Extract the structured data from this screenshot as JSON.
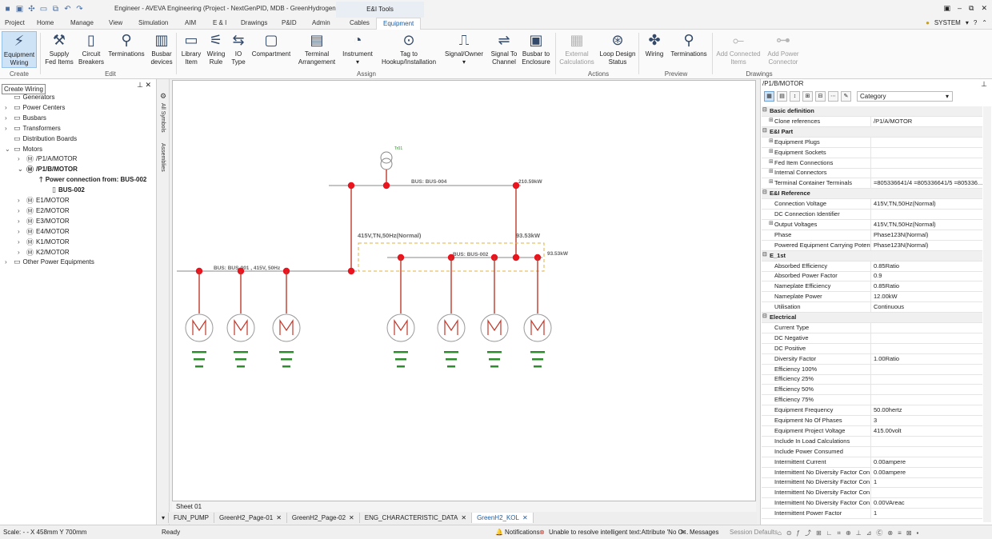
{
  "window": {
    "title": "Engineer - AVEVA Engineering (Project - NextGenPID, MDB - GreenHydrogen)",
    "context_tab": "E&I Tools"
  },
  "menu_tabs": [
    "Project",
    "Home",
    "Manage",
    "View",
    "Simulation",
    "AIM",
    "E & I",
    "Drawings",
    "P&ID",
    "Admin",
    "Cables",
    "Equipment"
  ],
  "active_tab": "Equipment",
  "user": {
    "name": "SYSTEM"
  },
  "ribbon": {
    "buttons": [
      {
        "label": "Equipment\nWiring",
        "icon": "wiring-icon"
      },
      {
        "label": "Supply\nFed Items",
        "icon": "plug-icon"
      },
      {
        "label": "Circuit\nBreakers",
        "icon": "breaker-icon"
      },
      {
        "label": "Terminations",
        "icon": "terminations-icon"
      },
      {
        "label": "Busbar\ndevices",
        "icon": "busbar-icon"
      },
      {
        "label": "Library\nItem",
        "icon": "library-icon"
      },
      {
        "label": "Wiring\nRule",
        "icon": "rule-icon"
      },
      {
        "label": "IO\nType",
        "icon": "io-icon"
      },
      {
        "label": "Compartment",
        "icon": "compartment-icon"
      },
      {
        "label": "Terminal\nArrangement",
        "icon": "terminal-icon"
      },
      {
        "label": "Instrument",
        "icon": "gauge-icon"
      },
      {
        "label": "Tag to\nHookup/Installation",
        "icon": "tag-icon"
      },
      {
        "label": "Signal/Owner",
        "icon": "signal-icon"
      },
      {
        "label": "Signal To\nChannel",
        "icon": "channel-icon"
      },
      {
        "label": "Busbar to\nEnclosure",
        "icon": "enclosure-icon"
      },
      {
        "label": "External\nCalculations",
        "icon": "calc-icon"
      },
      {
        "label": "Loop Design\nStatus",
        "icon": "loop-icon"
      },
      {
        "label": "Wiring",
        "icon": "wiring-preview-icon"
      },
      {
        "label": "Terminations",
        "icon": "terminations-preview-icon"
      },
      {
        "label": "Add Connected\nItems",
        "icon": "add-items-icon"
      },
      {
        "label": "Add Power\nConnector",
        "icon": "add-power-icon"
      }
    ],
    "groups": [
      "Create",
      "Edit",
      "Assign",
      "Actions",
      "Preview",
      "Drawings"
    ]
  },
  "tooltip": "Create Wiring",
  "tree": [
    {
      "label": "Generators",
      "level": 0,
      "exp": "",
      "icon": "folder"
    },
    {
      "label": "Power Centers",
      "level": 0,
      "exp": ">",
      "icon": "folder"
    },
    {
      "label": "Busbars",
      "level": 0,
      "exp": ">",
      "icon": "folder"
    },
    {
      "label": "Transformers",
      "level": 0,
      "exp": ">",
      "icon": "folder"
    },
    {
      "label": "Distribution Boards",
      "level": 0,
      "exp": "",
      "icon": "folder"
    },
    {
      "label": "Motors",
      "level": 0,
      "exp": "v",
      "icon": "folder"
    },
    {
      "label": "/P1/A/MOTOR",
      "level": 1,
      "exp": ">",
      "icon": "motor"
    },
    {
      "label": "/P1/B/MOTOR",
      "level": 1,
      "exp": "v",
      "icon": "motor",
      "bold": true
    },
    {
      "label": "Power connection from: BUS-002",
      "level": 2,
      "exp": "",
      "icon": "arrow",
      "bold": true
    },
    {
      "label": "BUS-002",
      "level": 3,
      "exp": "",
      "icon": "bus",
      "bold": true
    },
    {
      "label": "E1/MOTOR",
      "level": 1,
      "exp": ">",
      "icon": "motor"
    },
    {
      "label": "E2/MOTOR",
      "level": 1,
      "exp": ">",
      "icon": "motor"
    },
    {
      "label": "E3/MOTOR",
      "level": 1,
      "exp": ">",
      "icon": "motor"
    },
    {
      "label": "E4/MOTOR",
      "level": 1,
      "exp": ">",
      "icon": "motor"
    },
    {
      "label": "K1/MOTOR",
      "level": 1,
      "exp": ">",
      "icon": "motor"
    },
    {
      "label": "K2/MOTOR",
      "level": 1,
      "exp": ">",
      "icon": "motor"
    },
    {
      "label": "Other Power Equipments",
      "level": 0,
      "exp": ">",
      "icon": "folder"
    }
  ],
  "side_strip": [
    "All Symbols",
    "Assemblies"
  ],
  "diagram": {
    "bus_labels": [
      "BUS: BUS-004",
      "BUS: BUS-001 , 415V, 50Hz",
      "BUS: BUS-002"
    ],
    "voltage_label": "415V,TN,50Hz(Normal)",
    "power_labels": [
      "210.59kW",
      "93.53kW",
      "93.53kW"
    ],
    "transformer_label": "Tr01"
  },
  "sheet_tab": "Sheet 01",
  "doc_tabs": [
    "FUN_PUMP",
    "GreenH2_Page-01",
    "GreenH2_Page-02",
    "ENG_CHARACTERISTIC_DATA",
    "GreenH2_KOL"
  ],
  "active_doc": "GreenH2_KOL",
  "properties": {
    "header": "/P1/B/MOTOR",
    "category_select": "Category",
    "rows": [
      {
        "cat": true,
        "name": "Basic definition"
      },
      {
        "name": "Clone references",
        "value": "/P1/A/MOTOR",
        "exp": true
      },
      {
        "cat": true,
        "name": "E&I Part"
      },
      {
        "name": "Equipment Plugs",
        "value": "",
        "exp": true
      },
      {
        "name": "Equipment Sockets",
        "value": "",
        "exp": true
      },
      {
        "name": "Fed Item Connections",
        "value": "",
        "exp": true
      },
      {
        "name": "Internal Connectors",
        "value": "",
        "exp": true
      },
      {
        "name": "Terminal Container Terminals",
        "value": "=805336641/4 =805336641/5 =805336...",
        "exp": true
      },
      {
        "cat": true,
        "name": "E&I Reference"
      },
      {
        "name": "Connection Voltage",
        "value": "415V,TN,50Hz(Normal)"
      },
      {
        "name": "DC Connection Identifier",
        "value": ""
      },
      {
        "name": "Output Voltages",
        "value": "415V,TN,50Hz(Normal)",
        "exp": true
      },
      {
        "name": "Phase",
        "value": "Phase123N(Normal)"
      },
      {
        "name": "Powered Equipment Carrying Potential",
        "value": "Phase123N(Normal)"
      },
      {
        "cat": true,
        "name": "E_1st"
      },
      {
        "name": "Absorbed Efficiency",
        "value": "0.85Ratio"
      },
      {
        "name": "Absorbed Power Factor",
        "value": "0.9"
      },
      {
        "name": "Nameplate Efficiency",
        "value": "0.85Ratio"
      },
      {
        "name": "Nameplate Power",
        "value": "12.00kW"
      },
      {
        "name": "Utilisation",
        "value": "Continuous"
      },
      {
        "cat": true,
        "name": "Electrical"
      },
      {
        "name": "Current Type",
        "value": ""
      },
      {
        "name": "DC Negative",
        "value": ""
      },
      {
        "name": "DC Positive",
        "value": ""
      },
      {
        "name": "Diversity Factor",
        "value": "1.00Ratio"
      },
      {
        "name": "Efficiency 100%",
        "value": ""
      },
      {
        "name": "Efficiency 25%",
        "value": ""
      },
      {
        "name": "Efficiency 50%",
        "value": ""
      },
      {
        "name": "Efficiency 75%",
        "value": ""
      },
      {
        "name": "Equipment Frequency",
        "value": "50.00hertz"
      },
      {
        "name": "Equipment No Of Phases",
        "value": "3"
      },
      {
        "name": "Equipment Project Voltage",
        "value": "415.00volt"
      },
      {
        "name": "Include In Load Calculations",
        "value": ""
      },
      {
        "name": "Include Power Consumed",
        "value": ""
      },
      {
        "name": "Intermittent Current",
        "value": "0.00ampere"
      },
      {
        "name": "Intermittent No Diversity Factor Con...",
        "value": "0.00ampere"
      },
      {
        "name": "Intermittent No Diversity Factor Con...",
        "value": "1"
      },
      {
        "name": "Intermittent No Diversity Factor Con...",
        "value": ""
      },
      {
        "name": "Intermittent No Diversity Factor Con...",
        "value": "0.00VAreac"
      },
      {
        "name": "Intermittent Power Factor",
        "value": "1"
      }
    ]
  },
  "status": {
    "scale": "Scale: - -",
    "coords": "X 458mm Y 700mm",
    "ready": "Ready",
    "notifications": "Notifications",
    "error": "Unable to resolve intelligent text:Attribute 'No O...",
    "messages": "Messages",
    "session": "Session Defaults"
  },
  "colors": {
    "accent": "#1a5ea8",
    "wire": "#c0392b",
    "node": "#e8141e",
    "highlight": "#e0b040"
  }
}
